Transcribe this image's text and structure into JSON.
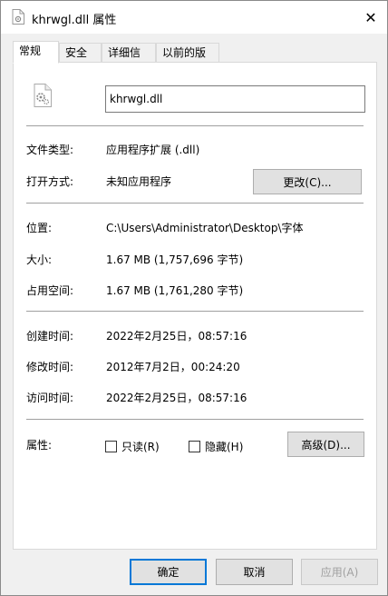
{
  "window": {
    "title": "khrwgl.dll 属性",
    "close_glyph": "✕"
  },
  "tabs": [
    {
      "label": "常规"
    },
    {
      "label": "安全"
    },
    {
      "label": "详细信息"
    },
    {
      "label": "以前的版本"
    }
  ],
  "general": {
    "file_name": "khrwgl.dll",
    "type_label": "文件类型:",
    "type_value": "应用程序扩展 (.dll)",
    "opens_with_label": "打开方式:",
    "opens_with_value": "未知应用程序",
    "change_button": "更改(C)...",
    "location_label": "位置:",
    "location_value": "C:\\Users\\Administrator\\Desktop\\字体",
    "size_label": "大小:",
    "size_value": "1.67 MB (1,757,696 字节)",
    "size_on_disk_label": "占用空间:",
    "size_on_disk_value": "1.67 MB (1,761,280 字节)",
    "created_label": "创建时间:",
    "created_value": "2022年2月25日，08:57:16",
    "modified_label": "修改时间:",
    "modified_value": "2012年7月2日，00:24:20",
    "accessed_label": "访问时间:",
    "accessed_value": "2022年2月25日，08:57:16",
    "attributes_label": "属性:",
    "readonly_label": "只读(R)",
    "hidden_label": "隐藏(H)",
    "advanced_button": "高级(D)..."
  },
  "footer": {
    "ok_button": "确定",
    "cancel_button": "取消",
    "apply_button": "应用(A)"
  },
  "colors": {
    "accent": "#0078d7",
    "panel": "#ffffff",
    "window": "#f0f0f0"
  }
}
